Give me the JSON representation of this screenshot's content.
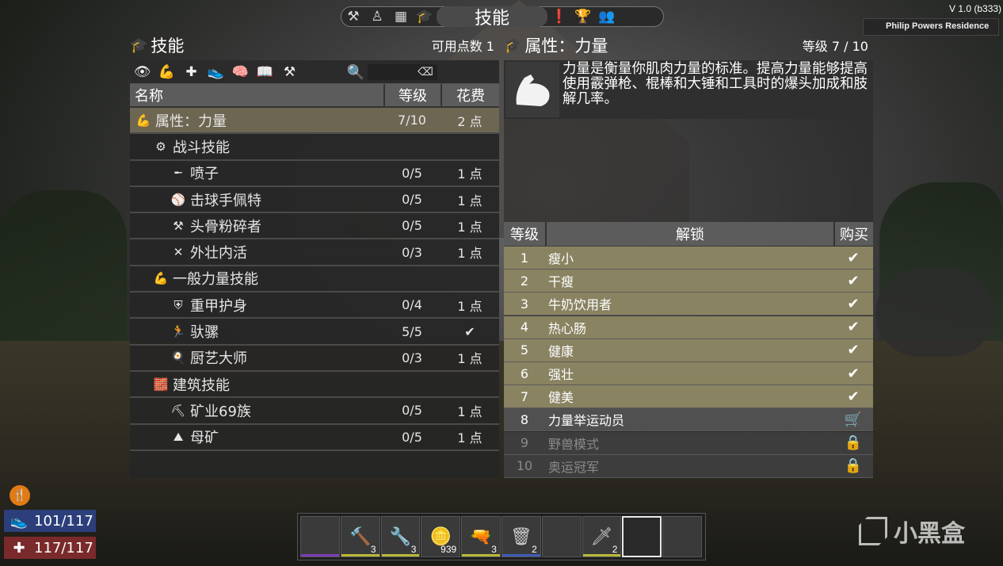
{
  "topbar": {
    "icons": [
      "hammer-icon",
      "character-icon",
      "map-icon",
      "skills-icon",
      "challenges-icon",
      "trophy-icon",
      "players-icon"
    ],
    "title": "技能"
  },
  "version": "V 1.0 (b333)",
  "location": "Philip Powers Residence",
  "skills_panel": {
    "title": "技能",
    "points_label": "可用点数 1",
    "filter_icons": [
      "eye-icon",
      "arm-icon",
      "plus-icon",
      "shoe-icon",
      "brain-icon",
      "book-icon",
      "hammer-icon"
    ],
    "search_placeholder": "",
    "columns": {
      "name": "名称",
      "level": "等级",
      "cost": "花费"
    },
    "rows": [
      {
        "indent": 0,
        "icon": "💪",
        "name": "属性：力量",
        "level": "7/10",
        "cost": "2 点",
        "selected": true
      },
      {
        "indent": 1,
        "icon": "⚙",
        "name": "战斗技能",
        "level": "",
        "cost": ""
      },
      {
        "indent": 2,
        "icon": "╾",
        "name": "喷子",
        "level": "0/5",
        "cost": "1 点"
      },
      {
        "indent": 2,
        "icon": "⚾",
        "name": "击球手佩特",
        "level": "0/5",
        "cost": "1 点"
      },
      {
        "indent": 2,
        "icon": "⚒",
        "name": "头骨粉碎者",
        "level": "0/5",
        "cost": "1 点"
      },
      {
        "indent": 2,
        "icon": "✕",
        "name": "外壮内活",
        "level": "0/3",
        "cost": "1 点"
      },
      {
        "indent": 1,
        "icon": "💪",
        "name": "一般力量技能",
        "level": "",
        "cost": ""
      },
      {
        "indent": 2,
        "icon": "⛨",
        "name": "重甲护身",
        "level": "0/4",
        "cost": "1 点"
      },
      {
        "indent": 2,
        "icon": "🏃",
        "name": "驮骡",
        "level": "5/5",
        "cost": "✔"
      },
      {
        "indent": 2,
        "icon": "🍳",
        "name": "厨艺大师",
        "level": "0/3",
        "cost": "1 点"
      },
      {
        "indent": 1,
        "icon": "🧱",
        "name": "建筑技能",
        "level": "",
        "cost": ""
      },
      {
        "indent": 2,
        "icon": "⛏",
        "name": "矿业69族",
        "level": "0/5",
        "cost": "1 点"
      },
      {
        "indent": 2,
        "icon": "⛰",
        "name": "母矿",
        "level": "0/5",
        "cost": "1 点"
      }
    ]
  },
  "attribute_panel": {
    "title": "属性：力量",
    "level_label": "等级 7 / 10",
    "description": "力量是衡量你肌肉力量的标准。提高力量能够提高使用霰弹枪、棍棒和大锤和工具时的爆头加成和肢解几率。",
    "columns": {
      "level": "等级",
      "unlock": "解锁",
      "buy": "购买"
    },
    "unlocks": [
      {
        "level": "1",
        "name": "瘦小",
        "status": "owned",
        "mark": "✔"
      },
      {
        "level": "2",
        "name": "干瘦",
        "status": "owned",
        "mark": "✔"
      },
      {
        "level": "3",
        "name": "牛奶饮用者",
        "status": "owned",
        "mark": "✔"
      },
      {
        "level": "4",
        "name": "热心肠",
        "status": "owned",
        "mark": "✔"
      },
      {
        "level": "5",
        "name": "健康",
        "status": "owned",
        "mark": "✔"
      },
      {
        "level": "6",
        "name": "强壮",
        "status": "owned",
        "mark": "✔"
      },
      {
        "level": "7",
        "name": "健美",
        "status": "owned",
        "mark": "✔"
      },
      {
        "level": "8",
        "name": "力量举运动员",
        "status": "buy",
        "mark": "🛒"
      },
      {
        "level": "9",
        "name": "野兽模式",
        "status": "locked",
        "mark": "🔒"
      },
      {
        "level": "10",
        "name": "奥运冠军",
        "status": "locked",
        "mark": "🔒"
      }
    ]
  },
  "hud": {
    "stamina": "101/117",
    "health": "117/117"
  },
  "hotbar": [
    {
      "icon": "",
      "count": "",
      "quality_color": "#7a3fb5"
    },
    {
      "icon": "🔨",
      "count": "3",
      "quality_color": "#b8b83a"
    },
    {
      "icon": "🔧",
      "count": "3",
      "quality_color": "#b8b83a"
    },
    {
      "icon": "🪙",
      "count": "939",
      "quality_color": ""
    },
    {
      "icon": "🔫",
      "count": "3",
      "quality_color": "#b8b83a"
    },
    {
      "icon": "🗑",
      "count": "2",
      "quality_color": "#3f5ab5"
    },
    {
      "icon": "",
      "count": "",
      "quality_color": ""
    },
    {
      "icon": "🗡",
      "count": "2",
      "quality_color": "#b8b83a"
    },
    {
      "icon": "",
      "count": "",
      "quality_color": "",
      "active": true
    },
    {
      "icon": "",
      "count": "",
      "quality_color": ""
    }
  ],
  "watermark": "小黑盒"
}
